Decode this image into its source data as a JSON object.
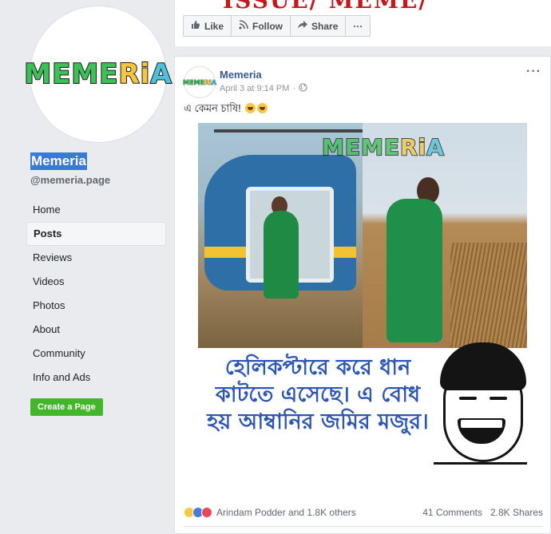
{
  "sidebar": {
    "page_name": "Memeria",
    "handle": "@memeria.page",
    "nav": [
      {
        "label": "Home"
      },
      {
        "label": "Posts"
      },
      {
        "label": "Reviews"
      },
      {
        "label": "Videos"
      },
      {
        "label": "Photos"
      },
      {
        "label": "About"
      },
      {
        "label": "Community"
      },
      {
        "label": "Info and Ads"
      }
    ],
    "active_nav": "Posts",
    "create_page_label": "Create a Page"
  },
  "logo": {
    "part1": "MEME",
    "part2": "Ri",
    "part3": "A"
  },
  "cover": {
    "text": "ISSUE/ MEME/"
  },
  "action_bar": {
    "like": "Like",
    "follow": "Follow",
    "share": "Share",
    "more": "···"
  },
  "post": {
    "author": "Memeria",
    "timestamp": "April 3 at 9:14 PM",
    "separator": "·",
    "privacy_icon": "globe-icon",
    "text": "এ কেমন চাষি!",
    "more": "···",
    "meme": {
      "caption_lines": [
        "হেলিকপ্টারে করে ধান",
        "কাটতে এসেছে। এ বোধ",
        "হয় আম্বানির জমির মজুর।"
      ]
    },
    "reactions_text": "Arindam Podder and 1.8K others",
    "comments": "41 Comments",
    "shares": "2.8K Shares"
  },
  "colors": {
    "link": "#385898",
    "page_bg": "#e9ebee",
    "create_button": "#42b72a",
    "caption": "#2d56b5"
  }
}
